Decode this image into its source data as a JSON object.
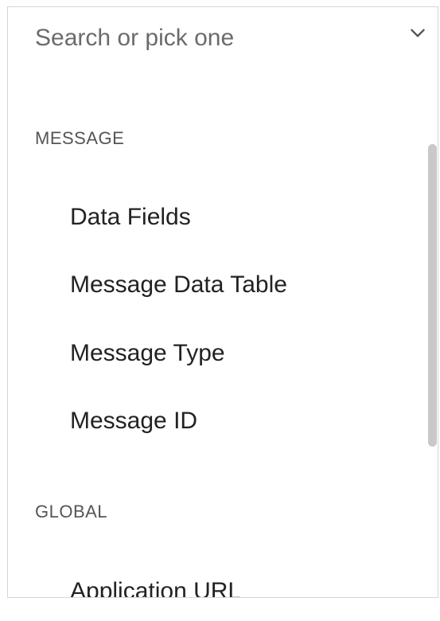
{
  "search": {
    "placeholder": "Search or pick one",
    "value": ""
  },
  "icons": {
    "dropdown_toggle": "chevron-down-icon"
  },
  "groups": [
    {
      "header": "MESSAGE",
      "options": [
        "Data Fields",
        "Message Data Table",
        "Message Type",
        "Message ID"
      ]
    },
    {
      "header": "GLOBAL",
      "options": [
        "Application URL"
      ]
    }
  ],
  "colors": {
    "border": "#d6d6d6",
    "placeholder": "#6b6b6b",
    "header_text": "#555555",
    "option_text": "#222222",
    "scrollbar_thumb": "#c9c9c9"
  }
}
